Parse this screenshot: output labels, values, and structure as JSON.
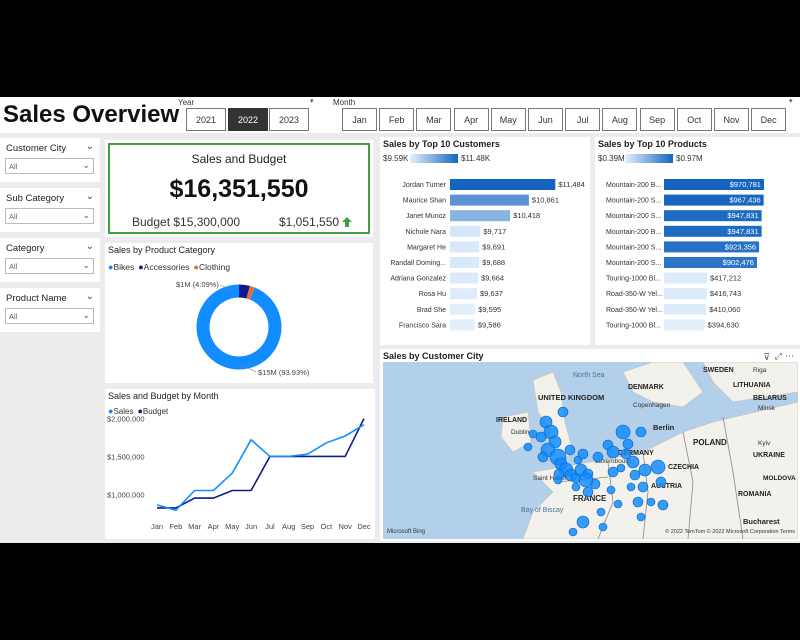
{
  "header": {
    "title": "Sales Overview",
    "year_label": "Year",
    "years": [
      "2021",
      "2022",
      "2023"
    ],
    "selected_year": "2022",
    "month_label": "Month",
    "months": [
      "Jan",
      "Feb",
      "Mar",
      "Apr",
      "May",
      "Jun",
      "Jul",
      "Aug",
      "Sep",
      "Oct",
      "Nov",
      "Dec"
    ]
  },
  "filters": [
    {
      "title": "Customer City",
      "value": "All"
    },
    {
      "title": "Sub Category",
      "value": "All"
    },
    {
      "title": "Category",
      "value": "All"
    },
    {
      "title": "Product Name",
      "value": "All"
    }
  ],
  "kpi": {
    "title": "Sales and Budget",
    "sales": "$16,351,550",
    "budget": "Budget $15,300,000",
    "variance": "$1,051,550",
    "border_color": "#3fa03f",
    "arrow_color": "#3fa03f"
  },
  "colors": {
    "dark_blue": "#0d1a8c",
    "blue": "#118dff",
    "orange": "#e66c37",
    "bar": "#1f6fc8"
  },
  "chart_data": [
    {
      "type": "pie",
      "title": "Sales by Product Category",
      "categories": [
        "Bikes",
        "Accessories",
        "Clothing"
      ],
      "values": [
        93.93,
        4.09,
        1.98
      ],
      "colors": [
        "#118dff",
        "#0d1a8c",
        "#e66c37"
      ],
      "labels": [
        "$15M (93.93%)",
        "$1M (4.09%)"
      ]
    },
    {
      "type": "line",
      "title": "Sales and Budget by Month",
      "x": [
        "Jan",
        "Feb",
        "Mar",
        "Apr",
        "May",
        "Jun",
        "Jul",
        "Aug",
        "Sep",
        "Oct",
        "Nov",
        "Dec"
      ],
      "yticks": [
        "$2,000,000",
        "$1,500,000",
        "$1,000,000"
      ],
      "ylim": [
        700000,
        2100000
      ],
      "series": [
        {
          "name": "Sales",
          "color": "#118dff",
          "values": [
            860000,
            790000,
            1050000,
            1050000,
            1280000,
            1720000,
            1500000,
            1500000,
            1530000,
            1680000,
            1770000,
            1920000
          ]
        },
        {
          "name": "Budget",
          "color": "#0d1a8c",
          "values": [
            820000,
            820000,
            950000,
            950000,
            1050000,
            1050000,
            1500000,
            1500000,
            1500000,
            1500000,
            1500000,
            2000000
          ]
        }
      ]
    },
    {
      "type": "bar",
      "title": "Sales by Top 10 Customers",
      "legend_min": "$9.59K",
      "legend_max": "$11.48K",
      "categories": [
        "Jordan Turner",
        "Maurice Shan",
        "Janet Munoz",
        "Nichole Nara",
        "Margaret He",
        "Randall Doming...",
        "Adriana Gonzalez",
        "Rosa Hu",
        "Brad She",
        "Francisco Sara"
      ],
      "values": [
        11484,
        10861,
        10418,
        9717,
        9691,
        9688,
        9664,
        9637,
        9595,
        9586
      ],
      "labels": [
        "$11,484",
        "$10,861",
        "$10,418",
        "$9,717",
        "$9,691",
        "$9,688",
        "$9,664",
        "$9,637",
        "$9,595",
        "$9,586"
      ]
    },
    {
      "type": "bar",
      "title": "Sales by Top 10 Products",
      "legend_min": "$0.39M",
      "legend_max": "$0.97M",
      "categories": [
        "Mountain-200 B...",
        "Mountain-200 S...",
        "Mountain-200 S...",
        "Mountain-200 B...",
        "Mountain-200 S...",
        "Mountain-200 S...",
        "Touring-1000 Bl...",
        "Road-350-W Yel...",
        "Road-350-W Yel...",
        "Touring-1000 Bl..."
      ],
      "values": [
        970781,
        967436,
        947831,
        947831,
        923356,
        902476,
        417212,
        416743,
        410060,
        394630
      ],
      "labels": [
        "$970,781",
        "$967,436",
        "$947,831",
        "$947,831",
        "$923,356",
        "$902,476",
        "$417,212",
        "$416,743",
        "$410,060",
        "$394,630"
      ]
    }
  ],
  "map": {
    "title": "Sales by Customer City",
    "labels": [
      {
        "text": "North Sea"
      },
      {
        "text": "UNITED KINGDOM"
      },
      {
        "text": "IRELAND"
      },
      {
        "text": "Dublin"
      },
      {
        "text": "Copenhagen"
      },
      {
        "text": "DENMARK"
      },
      {
        "text": "Berlin"
      },
      {
        "text": "POLAND"
      },
      {
        "text": "GERMANY"
      },
      {
        "text": "CZECHIA"
      },
      {
        "text": "UKRAINE"
      },
      {
        "text": "Kyiv"
      },
      {
        "text": "Luxembourg"
      },
      {
        "text": "FRANCE"
      },
      {
        "text": "Saint Helier"
      },
      {
        "text": "Bay of Biscay"
      },
      {
        "text": "AUSTRIA"
      },
      {
        "text": "ROMANIA"
      },
      {
        "text": "MOLDOVA"
      },
      {
        "text": "Bucharest"
      },
      {
        "text": "BELARUS"
      },
      {
        "text": "Minsk"
      },
      {
        "text": "LITHUANIA"
      },
      {
        "text": "Riga"
      },
      {
        "text": "SWEDEN"
      }
    ],
    "attribution": "© 2022 TomTom © 2022 Microsoft Corporation Terms",
    "bing": "Microsoft Bing"
  }
}
